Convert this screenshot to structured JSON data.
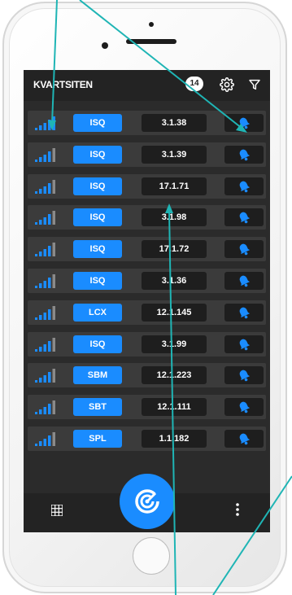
{
  "app": {
    "title": "KVARTSITEN",
    "notification_count": "14"
  },
  "colors": {
    "accent": "#1a8cff",
    "screen_bg": "#2b2b2b",
    "row_bg": "#3b3b3b",
    "annotation_line": "#1fb5b5"
  },
  "icons": {
    "settings": "gear-icon",
    "filter": "filter-icon",
    "signal": "signal-bars-icon",
    "bell": "bell-icon",
    "grid": "grid-icon",
    "more": "more-vertical-icon",
    "center": "radar-icon"
  },
  "rows": [
    {
      "tag": "ISQ",
      "code": "3.1.38"
    },
    {
      "tag": "ISQ",
      "code": "3.1.39"
    },
    {
      "tag": "ISQ",
      "code": "17.1.71"
    },
    {
      "tag": "ISQ",
      "code": "3.1.98"
    },
    {
      "tag": "ISQ",
      "code": "17.1.72"
    },
    {
      "tag": "ISQ",
      "code": "3.1.36"
    },
    {
      "tag": "LCX",
      "code": "12.1.145"
    },
    {
      "tag": "ISQ",
      "code": "3.1.99"
    },
    {
      "tag": "SBM",
      "code": "12.1.223"
    },
    {
      "tag": "SBT",
      "code": "12.1.111"
    },
    {
      "tag": "SPL",
      "code": "1.1.182"
    }
  ]
}
